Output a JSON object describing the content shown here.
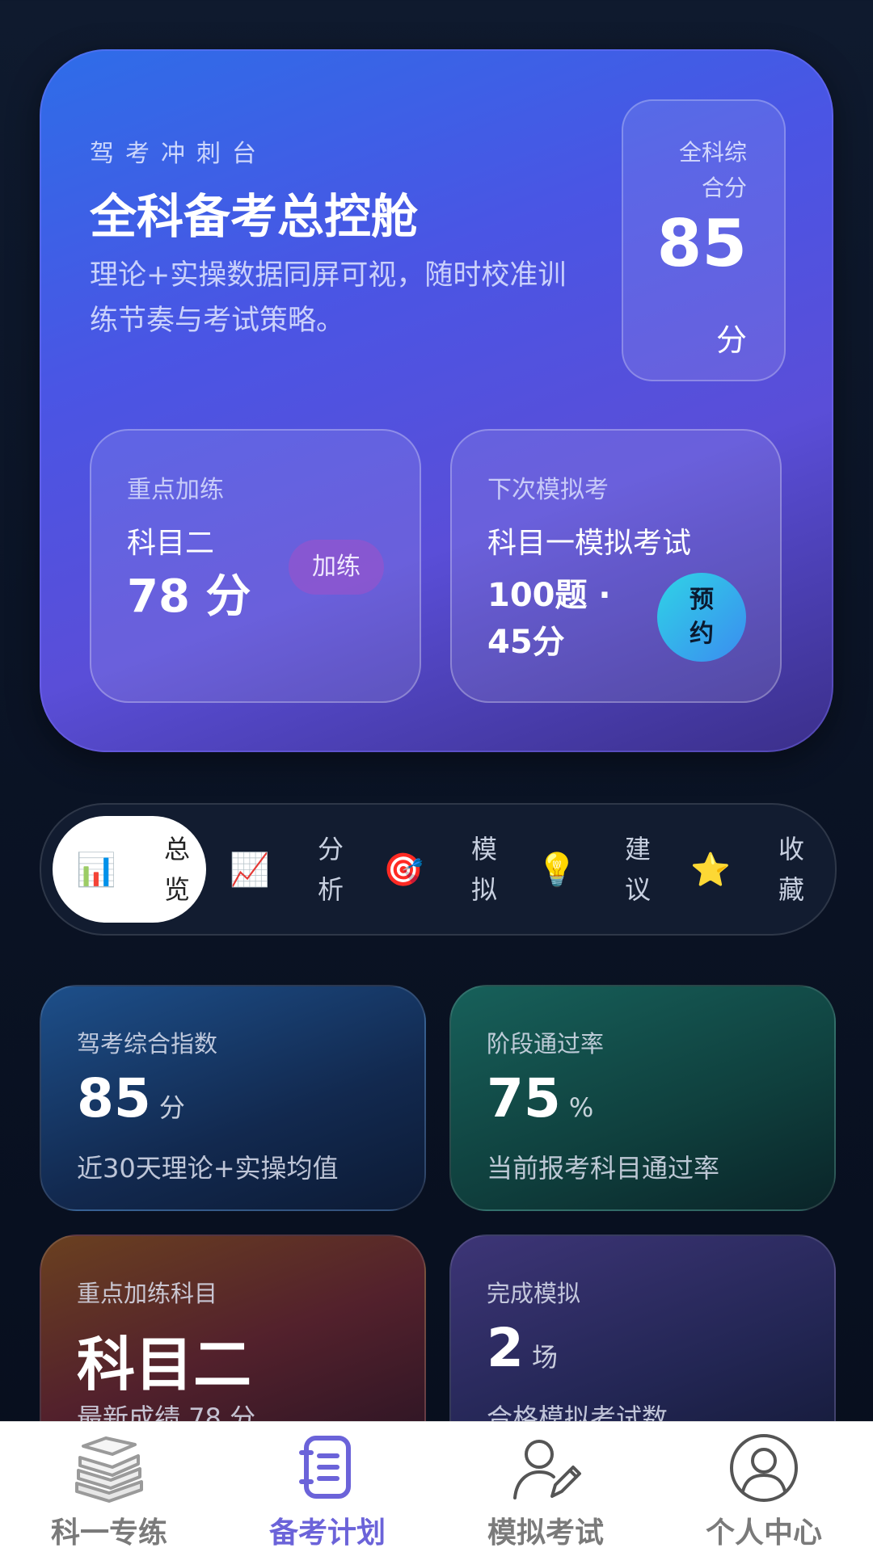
{
  "hero": {
    "subtitle": "驾考冲刺台",
    "title": "全科备考总控舱",
    "description": "理论+实操数据同屏可视，随时校准训练节奏与考试策略。",
    "score_box": {
      "label": "全科综合分",
      "value": "85",
      "unit": "分"
    },
    "focus_card": {
      "label": "重点加练",
      "subject": "科目二",
      "score": "78 分",
      "button": "加练"
    },
    "mock_card": {
      "label": "下次模拟考",
      "exam": "科目一模拟考试",
      "detail": "100题 · 45分",
      "button": "预约"
    }
  },
  "tabs": [
    {
      "icon": "📊",
      "label": "总览",
      "active": true
    },
    {
      "icon": "📈",
      "label": "分析",
      "active": false
    },
    {
      "icon": "🎯",
      "label": "模拟",
      "active": false
    },
    {
      "icon": "💡",
      "label": "建议",
      "active": false
    },
    {
      "icon": "⭐",
      "label": "收藏",
      "active": false
    }
  ],
  "cards": [
    {
      "label": "驾考综合指数",
      "value": "85",
      "unit": "分",
      "desc": "近30天理论+实操均值"
    },
    {
      "label": "阶段通过率",
      "value": "75",
      "unit": "%",
      "desc": "当前报考科目通过率"
    },
    {
      "label": "重点加练科目",
      "value": "科目二",
      "unit": "",
      "desc": "最新成绩 78 分"
    },
    {
      "label": "完成模拟",
      "value": "2",
      "unit": "场",
      "desc": "合格模拟考试数"
    }
  ],
  "bottom_nav": [
    {
      "label": "科一专练",
      "icon": "books-icon",
      "active": false
    },
    {
      "label": "备考计划",
      "icon": "plan-list-icon",
      "active": true
    },
    {
      "label": "模拟考试",
      "icon": "user-edit-icon",
      "active": false
    },
    {
      "label": "个人中心",
      "icon": "profile-icon",
      "active": false
    }
  ],
  "colors": {
    "accent": "#6b63d9",
    "hero_start": "#2e6de8",
    "hero_end": "#3b2f8a"
  }
}
